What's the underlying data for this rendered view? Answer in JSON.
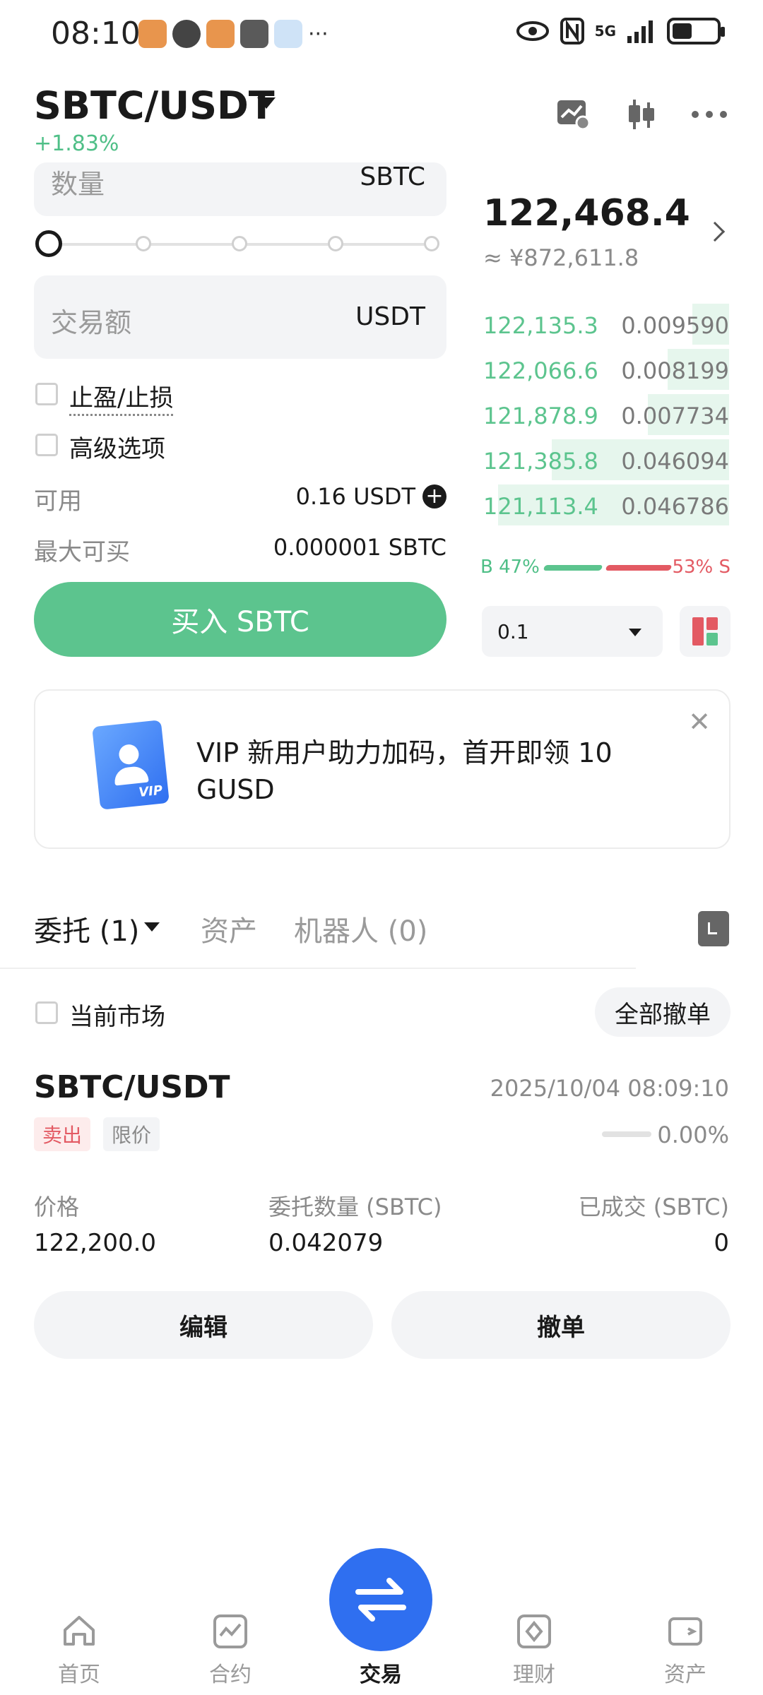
{
  "status_bar": {
    "time": "08:10",
    "network": "5G",
    "more": "···"
  },
  "header": {
    "pair": "SBTC/USDT",
    "change": "+1.83%",
    "icons": [
      "chart-settings-icon",
      "candlestick-icon",
      "more-icon"
    ]
  },
  "order_form": {
    "quantity_label": "数量",
    "quantity_unit": "SBTC",
    "amount_label": "交易额",
    "amount_unit": "USDT",
    "take_profit_label": "止盈/止损",
    "advanced_label": "高级选项",
    "available_label": "可用",
    "available_value": "0.16 USDT",
    "max_buy_label": "最大可买",
    "max_buy_value": "0.000001 SBTC",
    "buy_button": "买入 SBTC"
  },
  "order_book": {
    "last_price": "122,468.4",
    "cny_price": "≈ ¥872,611.8",
    "bids": [
      {
        "price": "122,135.3",
        "qty": "0.009590",
        "depth": 0.15
      },
      {
        "price": "122,066.6",
        "qty": "0.008199",
        "depth": 0.25
      },
      {
        "price": "121,878.9",
        "qty": "0.007734",
        "depth": 0.33
      },
      {
        "price": "121,385.8",
        "qty": "0.046094",
        "depth": 0.72
      },
      {
        "price": "121,113.4",
        "qty": "0.046786",
        "depth": 0.94
      }
    ],
    "buy_ratio": "B 47%",
    "sell_ratio": "53% S",
    "depth_value": "0.1"
  },
  "banner": {
    "text": "VIP 新用户助力加码，首开即领 10 GUSD",
    "card_text": "VIP",
    "close": "✕"
  },
  "tabs": {
    "orders": "委托 (1)",
    "assets": "资产",
    "bots": "机器人 (0)"
  },
  "filters": {
    "current_market": "当前市场",
    "cancel_all": "全部撤单"
  },
  "order": {
    "pair": "SBTC/USDT",
    "time": "2025/10/04 08:09:10",
    "side": "卖出",
    "type": "限价",
    "progress": "0.00%",
    "price_label": "价格",
    "price_value": "122,200.0",
    "qty_label": "委托数量 (SBTC)",
    "qty_value": "0.042079",
    "filled_label": "已成交 (SBTC)",
    "filled_value": "0",
    "edit_button": "编辑",
    "cancel_button": "撤单"
  },
  "bottom_nav": {
    "home": "首页",
    "futures": "合约",
    "trade": "交易",
    "earn": "理财",
    "assets": "资产"
  },
  "colors": {
    "buy_green": "#5cc48e",
    "sell_red": "#e35a63",
    "accent_blue": "#2f6ff0"
  }
}
